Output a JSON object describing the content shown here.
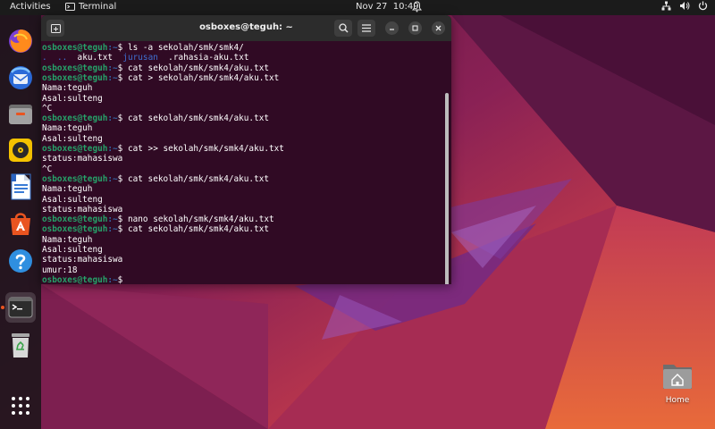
{
  "topbar": {
    "activities": "Activities",
    "app_name": "Terminal",
    "date": "Nov 27",
    "time": "10:49",
    "icons": [
      "network-icon",
      "volume-icon",
      "power-icon"
    ]
  },
  "dock": {
    "apps": [
      {
        "name": "Firefox",
        "icon": "firefox-icon"
      },
      {
        "name": "Thunderbird",
        "icon": "thunderbird-icon"
      },
      {
        "name": "Files",
        "icon": "files-icon"
      },
      {
        "name": "Rhythmbox",
        "icon": "rhythmbox-icon"
      },
      {
        "name": "LibreOffice Writer",
        "icon": "writer-icon"
      },
      {
        "name": "Ubuntu Software",
        "icon": "software-icon"
      },
      {
        "name": "Help",
        "icon": "help-icon"
      },
      {
        "name": "Terminal",
        "icon": "terminal-icon",
        "running": true
      },
      {
        "name": "Trash",
        "icon": "trash-icon"
      },
      {
        "name": "Show Applications",
        "icon": "app-grid-icon"
      }
    ]
  },
  "terminal": {
    "title": "osboxes@teguh: ~",
    "prompt_user": "osboxes@teguh",
    "prompt_path": ":~",
    "prompt_symbol": "$",
    "lines": [
      {
        "type": "cmd",
        "text": "ls -a sekolah/smk/smk4/"
      },
      {
        "type": "ls",
        "items": [
          ".",
          "..",
          "aku.txt",
          "jurusan",
          ".rahasia-aku.txt"
        ]
      },
      {
        "type": "cmd",
        "text": "cat sekolah/smk/smk4/aku.txt"
      },
      {
        "type": "cmd",
        "text": "cat > sekolah/smk/smk4/aku.txt"
      },
      {
        "type": "out",
        "text": "Nama:teguh"
      },
      {
        "type": "out",
        "text": "Asal:sulteng"
      },
      {
        "type": "out",
        "text": "^C"
      },
      {
        "type": "cmd",
        "text": "cat sekolah/smk/smk4/aku.txt"
      },
      {
        "type": "out",
        "text": "Nama:teguh"
      },
      {
        "type": "out",
        "text": "Asal:sulteng"
      },
      {
        "type": "cmd",
        "text": "cat >> sekolah/smk/smk4/aku.txt"
      },
      {
        "type": "out",
        "text": "status:mahasiswa"
      },
      {
        "type": "out",
        "text": "^C"
      },
      {
        "type": "cmd",
        "text": "cat sekolah/smk/smk4/aku.txt"
      },
      {
        "type": "out",
        "text": "Nama:teguh"
      },
      {
        "type": "out",
        "text": "Asal:sulteng"
      },
      {
        "type": "out",
        "text": "status:mahasiswa"
      },
      {
        "type": "cmd",
        "text": "nano sekolah/smk/smk4/aku.txt"
      },
      {
        "type": "cmd",
        "text": "cat sekolah/smk/smk4/aku.txt"
      },
      {
        "type": "out",
        "text": "Nama:teguh"
      },
      {
        "type": "out",
        "text": "Asal:sulteng"
      },
      {
        "type": "out",
        "text": "status:mahasiswa"
      },
      {
        "type": "out",
        "text": "umur:18"
      },
      {
        "type": "cmd",
        "text": ""
      }
    ]
  },
  "desktop": {
    "home_label": "Home"
  },
  "colors": {
    "terminal_bg": "#300a24",
    "prompt_user": "#26a269",
    "prompt_path": "#3465a4",
    "accent": "#e95420"
  }
}
